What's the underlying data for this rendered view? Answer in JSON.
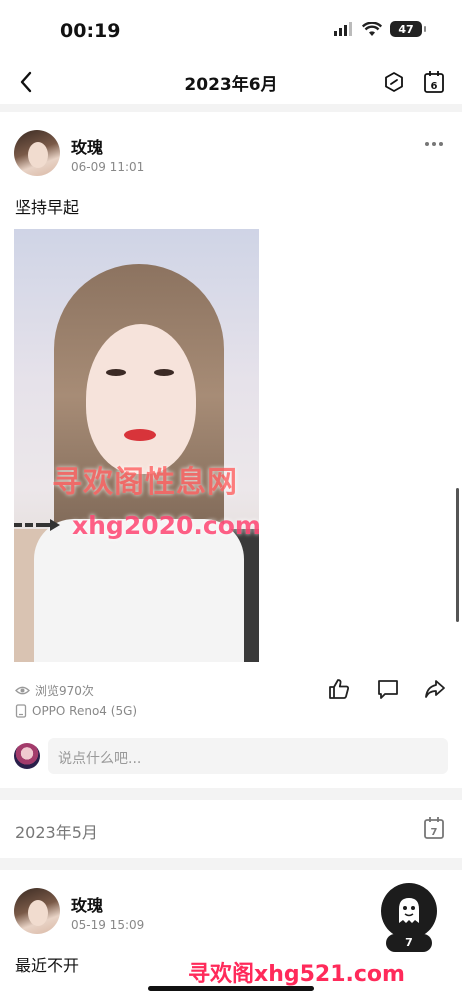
{
  "status_bar": {
    "time": "00:19",
    "battery": "47"
  },
  "nav": {
    "title": "2023年6月",
    "calendar_day": "6"
  },
  "posts": [
    {
      "author": "玫瑰",
      "time": "06-09 11:01",
      "text": "坚持早起",
      "watermark_line1": "寻欢阁性息网",
      "watermark_line2": "xhg2020.com",
      "views": "浏览970次",
      "device": "OPPO Reno4 (5G)",
      "comment_placeholder": "说点什么吧..."
    },
    {
      "author": "玫瑰",
      "time": "05-19 15:09",
      "text": "最近不开"
    }
  ],
  "section": {
    "title": "2023年5月",
    "calendar_day": "7"
  },
  "floating_button": {
    "count": "7"
  },
  "bottom_watermark": "寻欢阁xhg521.com",
  "icons": [
    "back-icon",
    "tag-icon",
    "calendar-icon",
    "more-icon",
    "eye-icon",
    "phone-icon",
    "like-icon",
    "comment-icon",
    "share-icon",
    "ghost-icon"
  ]
}
